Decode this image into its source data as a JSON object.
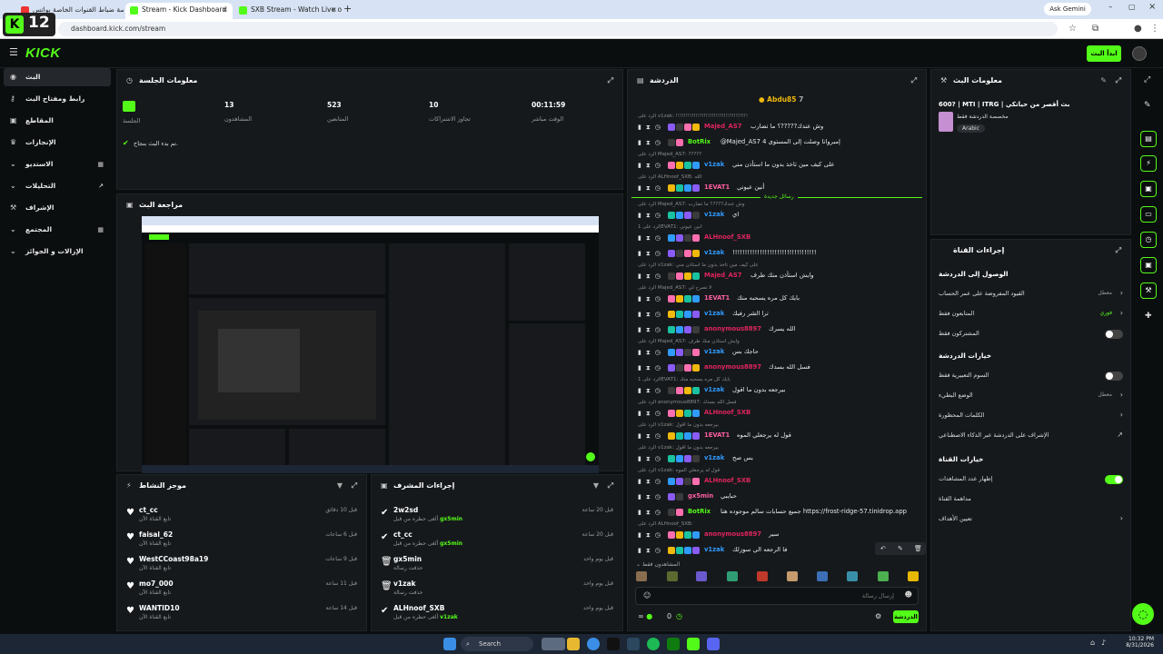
{
  "browser": {
    "tabs": [
      {
        "label": "قصة ضباط القنوات الخاصة بواتس",
        "active": false
      },
      {
        "label": "Stream - Kick Dashboard",
        "active": true
      },
      {
        "label": "SXB Stream - Watch Live on Kick",
        "active": false
      }
    ],
    "url": "dashboard.kick.com/stream",
    "ask_gemini": "Ask Gemini",
    "overlay_number": "12"
  },
  "header": {
    "logo": "KICK",
    "go_live_label": "ابدأ البث"
  },
  "sidebar": {
    "items": [
      {
        "label": "البث",
        "icon": "broadcast-icon",
        "active": true
      },
      {
        "label": "رابط ومفتاح البث",
        "icon": "key-icon"
      },
      {
        "label": "المقاطع",
        "icon": "clip-icon"
      },
      {
        "label": "الإنجازات",
        "icon": "trophy-icon"
      },
      {
        "label": "الاستديو",
        "icon": "studio-icon"
      },
      {
        "label": "التحليلات",
        "icon": "analytics-icon"
      },
      {
        "label": "الإشراف",
        "icon": "moderation-icon"
      },
      {
        "label": "المجتمع",
        "icon": "community-icon"
      },
      {
        "label": "الإزالات و الجوائز",
        "icon": "rewards-icon"
      }
    ]
  },
  "session": {
    "title": "معلومات الجلسة",
    "stats": [
      {
        "label": "الوقت مباشر",
        "value": "00:11:59"
      },
      {
        "label": "تجاوز الاشتراكات",
        "value": "10"
      },
      {
        "label": "المتابعين",
        "value": "523"
      },
      {
        "label": "المشاهدون",
        "value": "13"
      },
      {
        "label": "الجلسة",
        "value": ""
      }
    ],
    "status_text": "تم بدء البث بنجاح."
  },
  "preview": {
    "title": "مراجعة البث"
  },
  "activity": {
    "title": "موجز النشاط",
    "items": [
      {
        "user": "ct_cc",
        "sub": "تابع القناة الآن",
        "time": "قبل 10 دقائق"
      },
      {
        "user": "faisal_62",
        "sub": "تابع القناة الآن",
        "time": "قبل 6 ساعات"
      },
      {
        "user": "WestCCoast98a19",
        "sub": "تابع القناة الآن",
        "time": "قبل 9 ساعات"
      },
      {
        "user": "mo7_000",
        "sub": "تابع القناة الآن",
        "time": "قبل 11 ساعة"
      },
      {
        "user": "WANTID10",
        "sub": "تابع القناة الآن",
        "time": "قبل 14 ساعة"
      }
    ]
  },
  "mod_actions": {
    "title": "إجراءات المشرف",
    "items": [
      {
        "user": "2w2sd",
        "sub": "ألغى حظره من قبل",
        "by": "gx5min",
        "time": "قبل 20 ساعة"
      },
      {
        "user": "ct_cc",
        "sub": "ألغى حظره من قبل",
        "by": "gx5min",
        "time": "قبل 20 ساعة"
      },
      {
        "user": "gx5min",
        "sub": "حذفت رسالة",
        "by": "",
        "time": "قبل يوم واحد"
      },
      {
        "user": "v1zak",
        "sub": "حذفت رسالة",
        "by": "",
        "time": "قبل يوم واحد"
      },
      {
        "user": "ALHnoof_SXB",
        "sub": "ألغى حظره من قبل",
        "by": "v1zak",
        "time": "قبل يوم واحد"
      }
    ]
  },
  "chat": {
    "title": "الدردشة",
    "pinned_user": "Abdu85",
    "pinned_count": "7",
    "new_messages_label": "رسائل جديدة",
    "messages": [
      {
        "reply": "الرد على v1zak: !!!!!!!!!!!!!!!!!!!!!!!!!!!!!!!!!!!!",
        "name": "Majed_AS7",
        "color": "#e0245e",
        "text": "وش عندك?????؟ ما تضارب"
      },
      {
        "reply": "",
        "name": "BotRix",
        "color": "#53fc18",
        "text": "@Majed_AS7 إمبرواتا وصلت إلى المستوى 4"
      },
      {
        "reply": "الرد على Majed_AS7: ?????",
        "name": "v1zak",
        "color": "#2f9bff",
        "text": "على كيف مين تاخذ بدون ما استأذن مني"
      },
      {
        "reply": "الرد على ALHnoof_SXB: الله",
        "name": "1EVAT1",
        "color": "#ff5fa2",
        "text": "أنين عيوني"
      },
      {
        "reply": "الرد على Majed_AS7: وش عندك????؟ ما تضارب",
        "name": "v1zak",
        "color": "#2f9bff",
        "text": "اي"
      },
      {
        "reply": "الرد على 1EVAT1: أنين عيوني",
        "name": "ALHnoof_SXB",
        "color": "#e0245e",
        "text": ""
      },
      {
        "reply": "",
        "name": "v1zak",
        "color": "#2f9bff",
        "text": "!!!!!!!!!!!!!!!!!!!!!!!!!!!!!!!!!!"
      },
      {
        "reply": "الرد على v1zak: على كيف مين تاخذ بدون ما استأذن مني",
        "name": "Majed_AS7",
        "color": "#e0245e",
        "text": "وايش استأذن منك طرف"
      },
      {
        "reply": "الرد على Majed_AS7: لا تصرح لي",
        "name": "1EVAT1",
        "color": "#ff5fa2",
        "text": "بايك كل مره يسحبه منك"
      },
      {
        "reply": "",
        "name": "v1zak",
        "color": "#2f9bff",
        "text": "ترا الشر رفيك"
      },
      {
        "reply": "",
        "name": "anonymous8897",
        "color": "#e0245e",
        "text": "الله يسرك"
      },
      {
        "reply": "الرد على Majed_AS7: وايش استأذن منك طرف",
        "name": "v1zak",
        "color": "#2f9bff",
        "text": "حاجك بس"
      },
      {
        "reply": "",
        "name": "anonymous8897",
        "color": "#e0245e",
        "text": "فسل الله بسدك"
      },
      {
        "reply": "الرد على 1EVAT1: بايك كل مره يسحبه منك",
        "name": "v1zak",
        "color": "#2f9bff",
        "text": "بيرجعه بدون ما اقول"
      },
      {
        "reply": "الرد على anonymous8897: فسل الله بسدك",
        "name": "ALHnoof_SXB",
        "color": "#e0245e",
        "text": ""
      },
      {
        "reply": "الرد على v1zak: بيرجعه بدون ما اقول",
        "name": "1EVAT1",
        "color": "#ff5fa2",
        "text": "قول له يرجعلي الموه"
      },
      {
        "reply": "الرد على v1zak: بيرجعه بدون ما اقول",
        "name": "v1zak",
        "color": "#2f9bff",
        "text": "بس صح"
      },
      {
        "reply": "الرد على v1zak: قول له يرجعلي الموه",
        "name": "ALHnoof_SXB",
        "color": "#e0245e",
        "text": ""
      },
      {
        "reply": "",
        "name": "gx5min",
        "color": "#ff5fa2",
        "text": "حبايبي"
      },
      {
        "reply": "",
        "name": "BotRix",
        "color": "#53fc18",
        "text": "جميع حسابات سالم موجوده هنا https://frost-ridge-57.tinidrop.app"
      },
      {
        "reply": "الرد على ALHnoof_SXB:",
        "name": "anonymous8897",
        "color": "#e0245e",
        "text": "سير"
      },
      {
        "reply": "",
        "name": "v1zak",
        "color": "#2f9bff",
        "text": "فا الرجعه الي سوزلك"
      }
    ],
    "reply_hint": "المشاهدون فقط",
    "input_placeholder": "إرسال رسالة",
    "send_label": "الدردشة",
    "footer_count": "0"
  },
  "stream_info": {
    "title": "معلومات البث",
    "stream_title": "600? | MTI | ITRG | بث أقصر من حياتكي",
    "category": "مخصصة الدردشة فقط",
    "language": "Arabic"
  },
  "channel_actions": {
    "title": "إجراءات القناة",
    "sections": [
      {
        "heading": "الوصول إلى الدردشة",
        "rows": [
          {
            "label": "القيود المفروضة على عمر الحساب",
            "value": "معطل",
            "kind": "chevron"
          },
          {
            "label": "المتابعون فقط",
            "value": "فوري",
            "kind": "chevron"
          },
          {
            "label": "المشتركون فقط",
            "value": "",
            "kind": "toggle",
            "on": false
          }
        ]
      },
      {
        "heading": "خيارات الدردشة",
        "rows": [
          {
            "label": "السوم التعبيرية فقط",
            "value": "",
            "kind": "toggle",
            "on": false
          },
          {
            "label": "الوضع البطيء",
            "value": "معطل",
            "kind": "chevron"
          },
          {
            "label": "الكلمات المحظورة",
            "value": "",
            "kind": "chevron"
          },
          {
            "label": "الإشراف على الدردشة عبر الذكاء الاصطناعي",
            "value": "",
            "kind": "external"
          }
        ]
      },
      {
        "heading": "خيارات القناة",
        "rows": [
          {
            "label": "إظهار عدد المشاهدات",
            "value": "",
            "kind": "toggle",
            "on": true
          },
          {
            "label": "مداهمة القناة",
            "value": "",
            "kind": "none"
          },
          {
            "label": "تعيين الأهداف",
            "value": "",
            "kind": "chevron"
          }
        ]
      }
    ]
  },
  "taskbar": {
    "search_label": "Search",
    "time": "10:32 PM",
    "date": "8/31/2026"
  },
  "colors": {
    "accent": "#53fc18",
    "panel": "#16191c",
    "bg": "#0b0e0f"
  }
}
